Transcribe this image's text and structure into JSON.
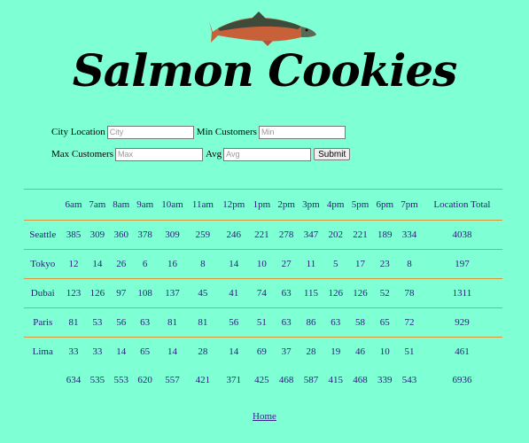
{
  "header": {
    "title": "Salmon Cookies",
    "logo_icon": "salmon-fish-icon"
  },
  "form": {
    "city_label": "City Location",
    "city_placeholder": "City",
    "min_label": "Min Customers",
    "min_placeholder": "Min",
    "max_label": "Max Customers",
    "max_placeholder": "Max",
    "avg_label": "Avg",
    "avg_placeholder": "Avg",
    "submit_label": "Submit"
  },
  "table": {
    "headers": [
      "",
      "6am",
      "7am",
      "8am",
      "9am",
      "10am",
      "11am",
      "12pm",
      "1pm",
      "2pm",
      "3pm",
      "4pm",
      "5pm",
      "6pm",
      "7pm",
      "Location Total"
    ],
    "rows": [
      {
        "location": "Seattle",
        "values": [
          "385",
          "309",
          "360",
          "378",
          "309",
          "259",
          "246",
          "221",
          "278",
          "347",
          "202",
          "221",
          "189",
          "334"
        ],
        "total": "4038"
      },
      {
        "location": "Tokyo",
        "values": [
          "12",
          "14",
          "26",
          "6",
          "16",
          "8",
          "14",
          "10",
          "27",
          "11",
          "5",
          "17",
          "23",
          "8"
        ],
        "total": "197"
      },
      {
        "location": "Dubai",
        "values": [
          "123",
          "126",
          "97",
          "108",
          "137",
          "45",
          "41",
          "74",
          "63",
          "115",
          "126",
          "126",
          "52",
          "78"
        ],
        "total": "1311"
      },
      {
        "location": "Paris",
        "values": [
          "81",
          "53",
          "56",
          "63",
          "81",
          "81",
          "56",
          "51",
          "63",
          "86",
          "63",
          "58",
          "65",
          "72"
        ],
        "total": "929"
      },
      {
        "location": "Lima",
        "values": [
          "33",
          "33",
          "14",
          "65",
          "14",
          "28",
          "14",
          "69",
          "37",
          "28",
          "19",
          "46",
          "10",
          "51"
        ],
        "total": "461"
      }
    ],
    "totals": {
      "label": "",
      "values": [
        "634",
        "535",
        "553",
        "620",
        "557",
        "421",
        "371",
        "425",
        "468",
        "587",
        "415",
        "468",
        "339",
        "543"
      ],
      "grand_total": "6936"
    }
  },
  "footer": {
    "home_link": "Home"
  },
  "colors": {
    "background": "#7fffd4",
    "table_border": "#d9963a",
    "table_text": "#2b1a7a"
  }
}
